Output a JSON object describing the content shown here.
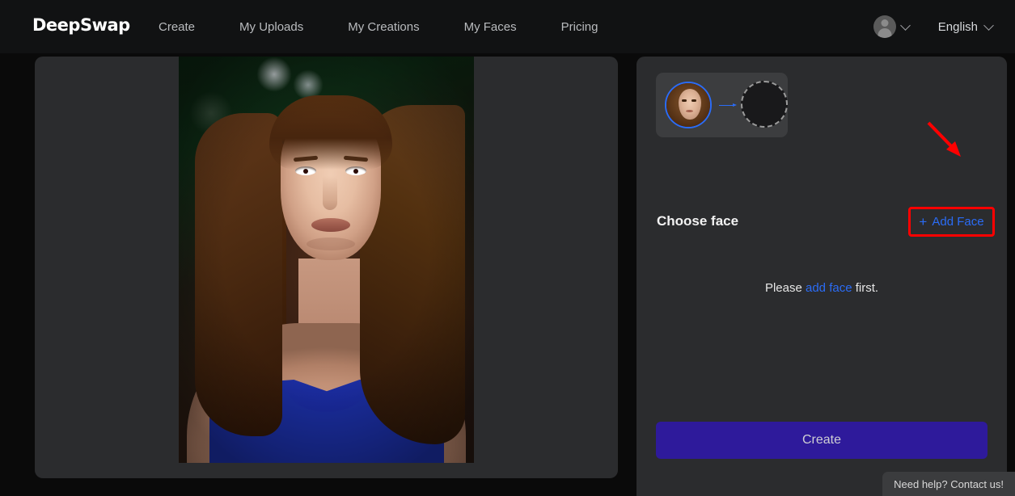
{
  "header": {
    "logo": "DeepSwap",
    "nav": [
      {
        "label": "Create"
      },
      {
        "label": "My Uploads"
      },
      {
        "label": "My Creations"
      },
      {
        "label": "My Faces"
      },
      {
        "label": "Pricing"
      }
    ],
    "account_icon": "user-avatar-icon",
    "account_caret_icon": "chevron-down-icon",
    "language": "English",
    "language_caret_icon": "chevron-down-icon"
  },
  "preview": {
    "alt": "uploaded-photo-of-woman-in-blue-dress"
  },
  "panel": {
    "face_pair": {
      "source_face_alt": "detected-source-face-thumbnail",
      "arrow_icon": "arrow-right-icon",
      "target_slot_alt": "empty-target-face-slot"
    },
    "choose_face_label": "Choose face",
    "add_face": {
      "plus_icon": "plus-icon",
      "label": "Add Face"
    },
    "empty_hint": {
      "prefix": "Please ",
      "link": "add face",
      "suffix": " first."
    },
    "create_label": "Create"
  },
  "support": {
    "label": "Need help? Contact us!"
  },
  "annotation": {
    "box_color": "#ff0000",
    "arrow_color": "#ff0000"
  },
  "colors": {
    "page_background": "#0a0a0a",
    "header_background": "#111213",
    "panel_background": "#2b2c2e",
    "card_background": "#3c3d3f",
    "accent_blue": "#2b6cf6",
    "create_button": "#2e1a9b",
    "annotation_red": "#ff0000"
  }
}
